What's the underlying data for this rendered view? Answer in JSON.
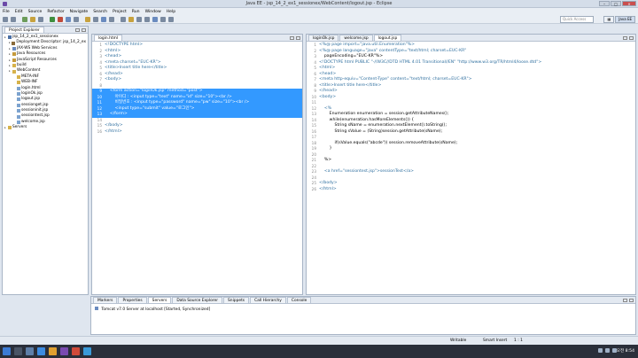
{
  "window": {
    "title": "Java EE - jsp_14_2_ex1_sessionex/WebContent/logout.jsp - Eclipse"
  },
  "menu": [
    "File",
    "Edit",
    "Source",
    "Refactor",
    "Navigate",
    "Search",
    "Project",
    "Run",
    "Window",
    "Help"
  ],
  "quick_access": {
    "placeholder": "Quick Access"
  },
  "perspectives": [
    {
      "label": "",
      "active": false
    },
    {
      "label": "Java EE",
      "active": true
    }
  ],
  "project_explorer": {
    "tab": "Project Explorer",
    "items": [
      {
        "label": "jsp_14_2_ex1_sessionex",
        "indent": 0,
        "icon": "#4a6fa5"
      },
      {
        "label": "Deployment Descriptor: jsp_14_2_ex",
        "indent": 1,
        "icon": "#8a6b3a"
      },
      {
        "label": "JAX-WS Web Services",
        "indent": 1,
        "icon": "#6a8bbf"
      },
      {
        "label": "Java Resources",
        "indent": 1,
        "icon": "#c59a3c"
      },
      {
        "label": "JavaScript Resources",
        "indent": 1,
        "icon": "#c59a3c"
      },
      {
        "label": "build",
        "indent": 1,
        "icon": "#d7b24a"
      },
      {
        "label": "WebContent",
        "indent": 1,
        "icon": "#d7b24a"
      },
      {
        "label": "META-INF",
        "indent": 2,
        "icon": "#d7b24a"
      },
      {
        "label": "WEB-INF",
        "indent": 2,
        "icon": "#d7b24a"
      },
      {
        "label": "login.html",
        "indent": 2,
        "icon": "#7da3cf"
      },
      {
        "label": "loginOk.jsp",
        "indent": 2,
        "icon": "#7da3cf"
      },
      {
        "label": "logout.jsp",
        "indent": 2,
        "icon": "#7da3cf"
      },
      {
        "label": "sessionget.jsp",
        "indent": 2,
        "icon": "#7da3cf"
      },
      {
        "label": "sessioninit.jsp",
        "indent": 2,
        "icon": "#7da3cf"
      },
      {
        "label": "sessiontest.jsp",
        "indent": 2,
        "icon": "#7da3cf"
      },
      {
        "label": "welcome.jsp",
        "indent": 2,
        "icon": "#7da3cf"
      },
      {
        "label": "Servers",
        "indent": 0,
        "icon": "#d7b24a"
      }
    ]
  },
  "editor_left": {
    "tab": "login.html",
    "lines": [
      {
        "n": "1",
        "t": "<!DOCTYPE html>",
        "sel": false
      },
      {
        "n": "2",
        "t": "<html>",
        "sel": false
      },
      {
        "n": "3",
        "t": "<head>",
        "sel": false
      },
      {
        "n": "4",
        "t": "<meta charset=\"EUC-KR\">",
        "sel": false
      },
      {
        "n": "5",
        "t": "<title>Insert title here</title>",
        "sel": false
      },
      {
        "n": "6",
        "t": "</head>",
        "sel": false
      },
      {
        "n": "7",
        "t": "<body>",
        "sel": false
      },
      {
        "n": "8",
        "t": "",
        "sel": false
      },
      {
        "n": "9",
        "t": "    <form action=\"loginOk.jsp\" method=\"post\">",
        "sel": true
      },
      {
        "n": "10",
        "t": "        아이디 : <input type=\"text\" name=\"id\" size=\"10\"><br />",
        "sel": true
      },
      {
        "n": "11",
        "t": "        비밀번호 : <input type=\"password\" name=\"pw\" size=\"10\"><br />",
        "sel": true
      },
      {
        "n": "12",
        "t": "        <input type=\"submit\" value=\"로그인\">",
        "sel": true
      },
      {
        "n": "13",
        "t": "    </form>",
        "sel": true
      },
      {
        "n": "14",
        "t": "",
        "sel": false
      },
      {
        "n": "15",
        "t": "</body>",
        "sel": false
      },
      {
        "n": "16",
        "t": "</html>",
        "sel": false
      }
    ]
  },
  "editor_right": {
    "tabs": [
      {
        "label": "loginOk.jsp",
        "active": false
      },
      {
        "label": "welcome.jsp",
        "active": false
      },
      {
        "label": "logout.jsp",
        "active": true
      }
    ],
    "lines": [
      {
        "n": "1",
        "t": "<%@ page import=\"java.util.Enumeration\"%>"
      },
      {
        "n": "2",
        "t": "<%@ page language=\"java\" contentType=\"text/html; charset=EUC-KR\""
      },
      {
        "n": "3",
        "t": "    pageEncoding=\"EUC-KR\"%>"
      },
      {
        "n": "4",
        "t": "<!DOCTYPE html PUBLIC \"-//W3C//DTD HTML 4.01 Transitional//EN\" \"http://www.w3.org/TR/html4/loose.dtd\">"
      },
      {
        "n": "5",
        "t": "<html>"
      },
      {
        "n": "6",
        "t": "<head>"
      },
      {
        "n": "7",
        "t": "<meta http-equiv=\"Content-Type\" content=\"text/html; charset=EUC-KR\">"
      },
      {
        "n": "8",
        "t": "<title>Insert title here</title>"
      },
      {
        "n": "9",
        "t": "</head>"
      },
      {
        "n": "10",
        "t": "<body>"
      },
      {
        "n": "11",
        "t": ""
      },
      {
        "n": "12",
        "t": "    <%"
      },
      {
        "n": "13",
        "t": "        Enumeration enumeration = session.getAttributeNames();"
      },
      {
        "n": "14",
        "t": "        while(enumeration.hasMoreElements()) {"
      },
      {
        "n": "15",
        "t": "            String sName = enumeration.nextElement().toString();"
      },
      {
        "n": "16",
        "t": "            String sValue = (String)session.getAttribute(sName);"
      },
      {
        "n": "17",
        "t": ""
      },
      {
        "n": "18",
        "t": "            if(sValue.equals(\"abcde\")) session.removeAttribute(sName);"
      },
      {
        "n": "19",
        "t": "        }"
      },
      {
        "n": "20",
        "t": ""
      },
      {
        "n": "21",
        "t": "    %>"
      },
      {
        "n": "22",
        "t": ""
      },
      {
        "n": "23",
        "t": "    <a href=\"sessiontest.jsp\">sessionTest</a>"
      },
      {
        "n": "24",
        "t": ""
      },
      {
        "n": "25",
        "t": "</body>"
      },
      {
        "n": "26",
        "t": "</html>"
      }
    ]
  },
  "console": {
    "tabs": [
      "Markers",
      "Properties",
      "Servers",
      "Data Source Explorer",
      "Snippets",
      "Call Hierarchy",
      "Console"
    ],
    "active_tab": "Servers",
    "line": "Tomcat v7.0 Server at localhost  [Started, Synchronized]"
  },
  "status": {
    "writable": "Writable",
    "insert": "Smart Insert",
    "position": "1 : 1"
  },
  "clock": "오전 8:54",
  "colors": {
    "selection": "#3399ff",
    "taskbar": "#2a2f3a"
  }
}
